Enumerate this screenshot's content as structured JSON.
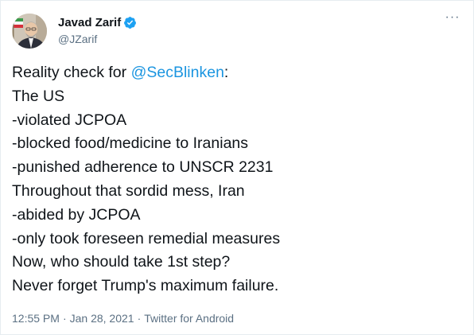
{
  "author": {
    "display_name": "Javad Zarif",
    "handle": "@JZarif",
    "verified": true,
    "avatar_icon": "profile-photo-with-flag"
  },
  "menu": {
    "more_glyph": "···"
  },
  "tweet": {
    "first_line_prefix": "Reality check for ",
    "first_line_mention": "@SecBlinken",
    "first_line_suffix": ":",
    "lines": [
      "The US",
      "-violated JCPOA",
      "-blocked food/medicine to Iranians",
      "-punished adherence to UNSCR 2231",
      "Throughout that sordid mess, Iran",
      "-abided by JCPOA",
      "-only took foreseen remedial measures",
      "Now, who should take 1st step?",
      "Never forget Trump's maximum failure."
    ]
  },
  "meta": {
    "time": "12:55 PM",
    "separator": "·",
    "date": "Jan 28, 2021",
    "separator2": "·",
    "source": "Twitter for Android"
  },
  "colors": {
    "link": "#1b95e0",
    "secondary_text": "#5b7083",
    "verified_badge": "#1da1f2"
  }
}
